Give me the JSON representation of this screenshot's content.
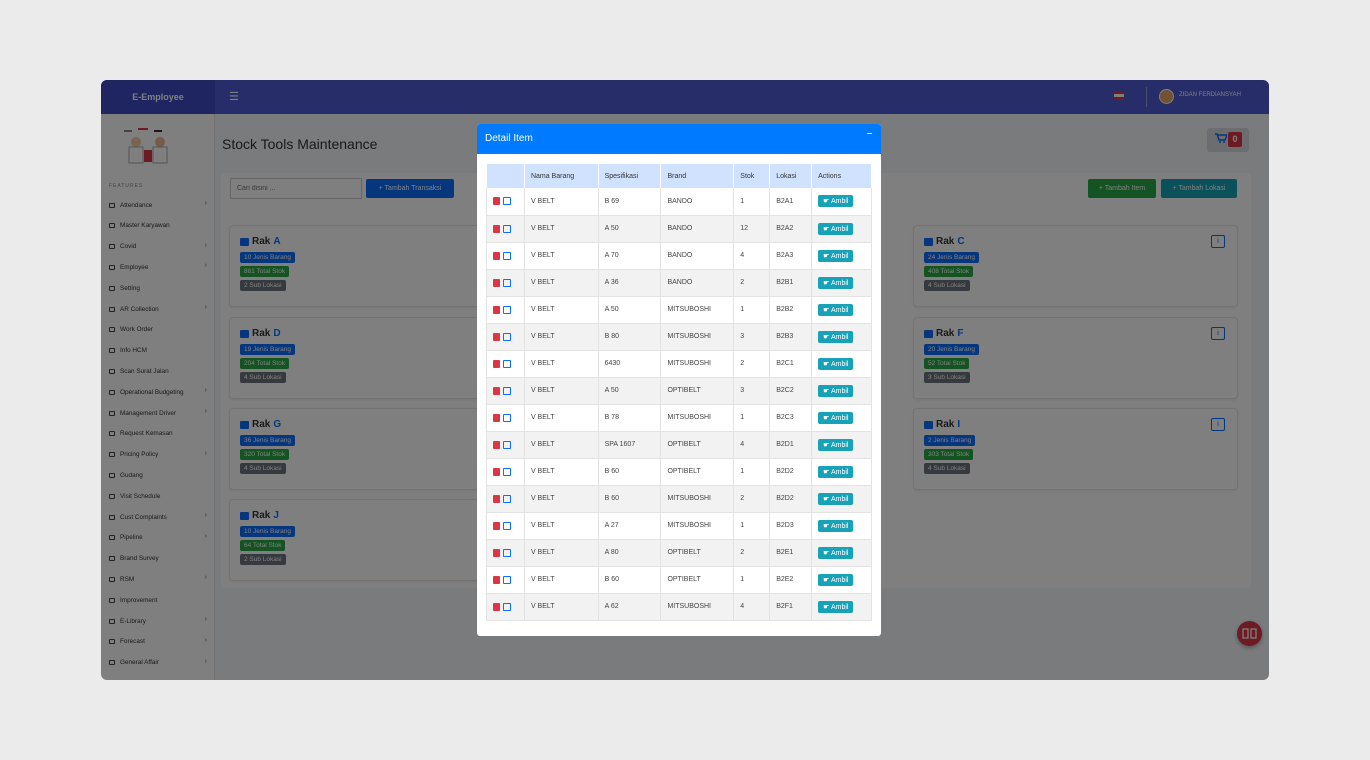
{
  "app": {
    "brand": "E-Employee",
    "user": "ZIDAN FERDIANSYAH",
    "cart_count": "0"
  },
  "sidebar": {
    "section": "FEATURES",
    "items": [
      {
        "label": "Attendance",
        "chev": true
      },
      {
        "label": "Master Karyawan",
        "chev": false
      },
      {
        "label": "Covid",
        "chev": true
      },
      {
        "label": "Employee",
        "chev": true
      },
      {
        "label": "Setting",
        "chev": false
      },
      {
        "label": "AR Collection",
        "chev": true
      },
      {
        "label": "Work Order",
        "chev": false
      },
      {
        "label": "Info HCM",
        "chev": false
      },
      {
        "label": "Scan Surat Jalan",
        "chev": false
      },
      {
        "label": "Operational Budgeting",
        "chev": true
      },
      {
        "label": "Management Driver",
        "chev": true
      },
      {
        "label": "Request Kemasan",
        "chev": false
      },
      {
        "label": "Pricing Policy",
        "chev": true
      },
      {
        "label": "Gudang",
        "chev": false
      },
      {
        "label": "Visit Schedule",
        "chev": false
      },
      {
        "label": "Cust Complaints",
        "chev": true
      },
      {
        "label": "Pipeline",
        "chev": true
      },
      {
        "label": "Brand Survey",
        "chev": false
      },
      {
        "label": "RSM",
        "chev": true
      },
      {
        "label": "Improvement",
        "chev": false
      },
      {
        "label": "E-Library",
        "chev": true
      },
      {
        "label": "Forecast",
        "chev": true
      },
      {
        "label": "General Affair",
        "chev": true
      }
    ]
  },
  "main": {
    "title": "Stock Tools Maintenance",
    "search_placeholder": "Cari disini ...",
    "btn_transaksi": "+ Tambah Transaksi",
    "btn_item": "+ Tambah Item",
    "btn_lokasi": "+ Tambah Lokasi",
    "info_icon": "i",
    "rak_prefix": "Rak",
    "racks": [
      {
        "name": "A",
        "jenis": "10 Jenis Barang",
        "stok": "881 Total Stok",
        "sub": "2 Sub Lokasi"
      },
      {
        "name": "C",
        "jenis": "24 Jenis Barang",
        "stok": "408 Total Stok",
        "sub": "4 Sub Lokasi"
      },
      {
        "name": "D",
        "jenis": "19 Jenis Barang",
        "stok": "204 Total Stok",
        "sub": "4 Sub Lokasi"
      },
      {
        "name": "F",
        "jenis": "20 Jenis Barang",
        "stok": "52 Total Stok",
        "sub": "3 Sub Lokasi"
      },
      {
        "name": "G",
        "jenis": "36 Jenis Barang",
        "stok": "320 Total Stok",
        "sub": "4 Sub Lokasi"
      },
      {
        "name": "I",
        "jenis": "2 Jenis Barang",
        "stok": "303 Total Stok",
        "sub": "4 Sub Lokasi"
      },
      {
        "name": "J",
        "jenis": "10 Jenis Barang",
        "stok": "64 Total Stok",
        "sub": "2 Sub Lokasi"
      }
    ]
  },
  "modal": {
    "title": "Detail Item",
    "minimize": "–",
    "columns": [
      "",
      "Nama Barang",
      "Spesifikasi",
      "Brand",
      "Stok",
      "Lokasi",
      "Actions"
    ],
    "action_label": "Ambil",
    "rows": [
      [
        "V BELT",
        "B 69",
        "BANDO",
        "1",
        "B2A1"
      ],
      [
        "V BELT",
        "A 50",
        "BANDO",
        "12",
        "B2A2"
      ],
      [
        "V BELT",
        "A 70",
        "BANDO",
        "4",
        "B2A3"
      ],
      [
        "V BELT",
        "A 36",
        "BANDO",
        "2",
        "B2B1"
      ],
      [
        "V BELT",
        "A 50",
        "MITSUBOSHI",
        "1",
        "B2B2"
      ],
      [
        "V BELT",
        "B 80",
        "MITSUBOSHI",
        "3",
        "B2B3"
      ],
      [
        "V BELT",
        "6430",
        "MITSUBOSHI",
        "2",
        "B2C1"
      ],
      [
        "V BELT",
        "A 50",
        "OPTIBELT",
        "3",
        "B2C2"
      ],
      [
        "V BELT",
        "B 78",
        "MITSUBOSHI",
        "1",
        "B2C3"
      ],
      [
        "V BELT",
        "SPA 1607",
        "OPTIBELT",
        "4",
        "B2D1"
      ],
      [
        "V BELT",
        "B 60",
        "OPTIBELT",
        "1",
        "B2D2"
      ],
      [
        "V BELT",
        "B 60",
        "MITSUBOSHI",
        "2",
        "B2D2"
      ],
      [
        "V BELT",
        "A 27",
        "MITSUBOSHI",
        "1",
        "B2D3"
      ],
      [
        "V BELT",
        "A 80",
        "OPTIBELT",
        "2",
        "B2E1"
      ],
      [
        "V BELT",
        "B 60",
        "OPTIBELT",
        "1",
        "B2E2"
      ],
      [
        "V BELT",
        "A 62",
        "MITSUBOSHI",
        "4",
        "B2F1"
      ]
    ]
  },
  "colors": {
    "primary": "#007bff",
    "topbar": "#4e5bd0",
    "success": "#28a745",
    "info": "#17a2b8",
    "danger": "#dc3545"
  }
}
